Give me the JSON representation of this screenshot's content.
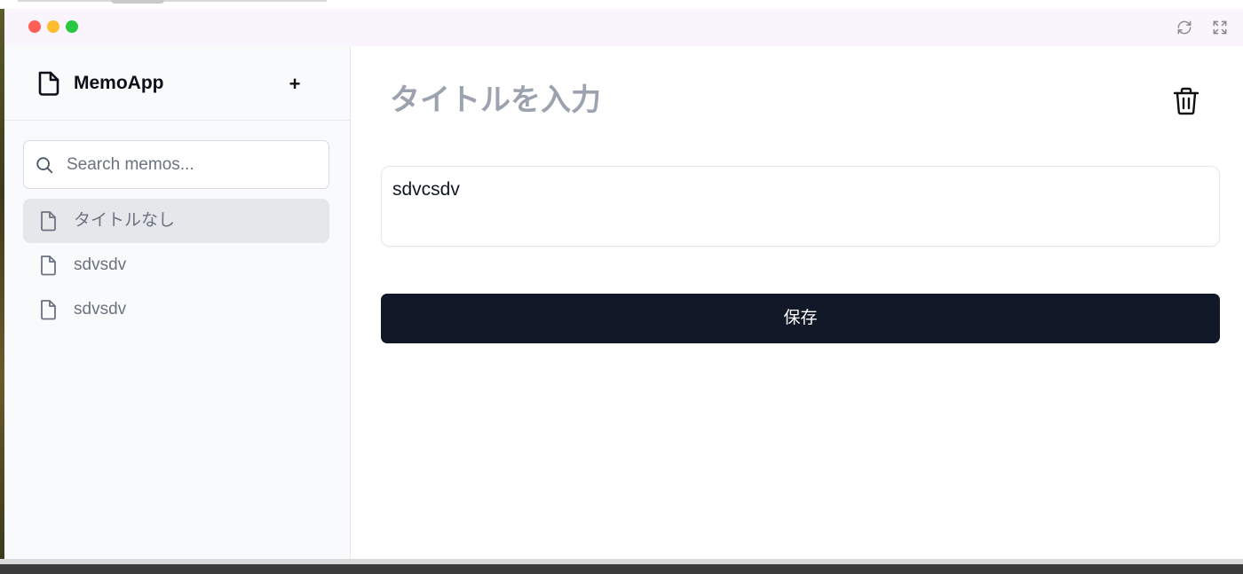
{
  "app": {
    "name": "MemoApp",
    "add_label": "+"
  },
  "search": {
    "placeholder": "Search memos..."
  },
  "memos": [
    {
      "label": "タイトルなし",
      "active": true
    },
    {
      "label": "sdvsdv",
      "active": false
    },
    {
      "label": "sdvsdv",
      "active": false
    }
  ],
  "editor": {
    "title_placeholder": "タイトルを入力",
    "body": "sdvcsdv",
    "save_label": "保存"
  },
  "colors": {
    "primary": "#111827",
    "sidebar_bg": "#f9fafb",
    "active_item": "#e5e7eb",
    "titlebar": "#faf5fd"
  },
  "icons": {
    "app": "document-icon",
    "search": "search-icon",
    "memo": "file-icon",
    "delete": "trash-icon",
    "refresh": "refresh-icon",
    "fullscreen": "expand-icon"
  }
}
